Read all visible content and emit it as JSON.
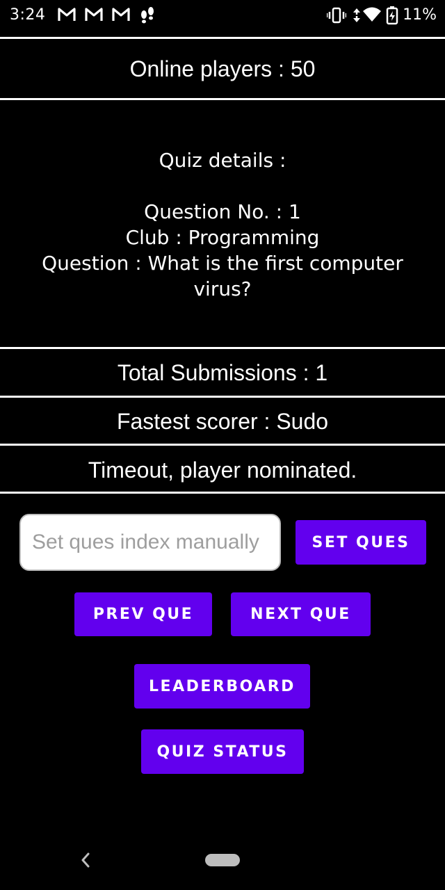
{
  "status_bar": {
    "time": "3:24",
    "battery": "11%",
    "icons": [
      "gmail-icon",
      "gmail-icon",
      "gmail-icon",
      "footsteps-icon",
      "vibrate-icon",
      "data-arrows-icon",
      "wifi-icon",
      "battery-charging-icon"
    ]
  },
  "online_players": "Online players : 50",
  "quiz": {
    "heading": "Quiz details :",
    "question_no": "Question No. : 1",
    "club": "Club : Programming",
    "question": "Question : What is the first computer virus?"
  },
  "total_submissions": "Total Submissions : 1",
  "fastest_scorer": "Fastest scorer : Sudo",
  "status_message": "Timeout, player nominated.",
  "input": {
    "placeholder": "Set ques index manually",
    "value": ""
  },
  "buttons": {
    "set_ques": "SET QUES",
    "prev_que": "PREV QUE",
    "next_que": "NEXT QUE",
    "leaderboard": "LEADERBOARD",
    "quiz_status": "QUIZ STATUS"
  },
  "colors": {
    "background": "#000000",
    "accent": "#6200ee",
    "text": "#ffffff"
  }
}
